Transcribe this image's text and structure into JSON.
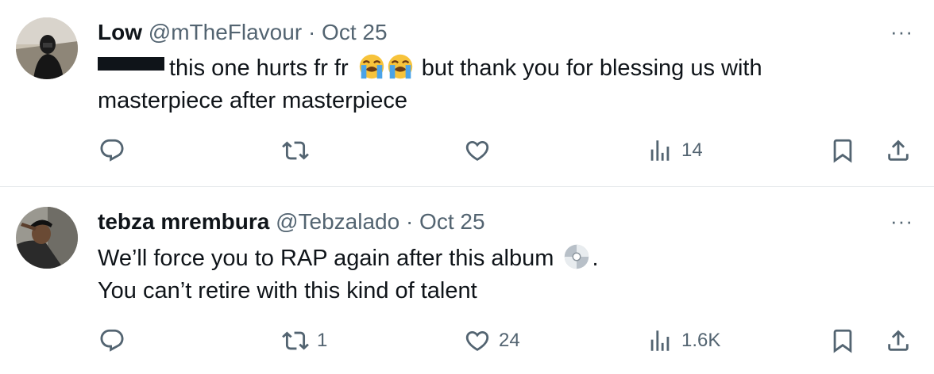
{
  "tweets": [
    {
      "name": "Low",
      "handle": "@mTheFlavour",
      "separator": "·",
      "date": "Oct 25",
      "text_line1": "this one hurts fr fr",
      "text_after_emoji": "but thank you for blessing us with",
      "text_line2": "masterpiece after masterpiece",
      "emojis": [
        "loudly-crying-face",
        "loudly-crying-face"
      ],
      "more": "···",
      "views": "14",
      "replies": "",
      "retweets": "",
      "likes": ""
    },
    {
      "name": "tebza mrembura",
      "handle": "@Tebzalado",
      "separator": "·",
      "date": "Oct 25",
      "text_line1": "We’ll force you to RAP again after this album",
      "text_after_emoji": ".",
      "text_line2": "You can’t retire with this kind of talent",
      "emojis": [
        "optical-disc"
      ],
      "more": "···",
      "views": "1.6K",
      "replies": "",
      "retweets": "1",
      "likes": "24"
    }
  ],
  "colors": {
    "text": "#0f1419",
    "secondary": "#536471",
    "divider": "#e6e9ec"
  }
}
